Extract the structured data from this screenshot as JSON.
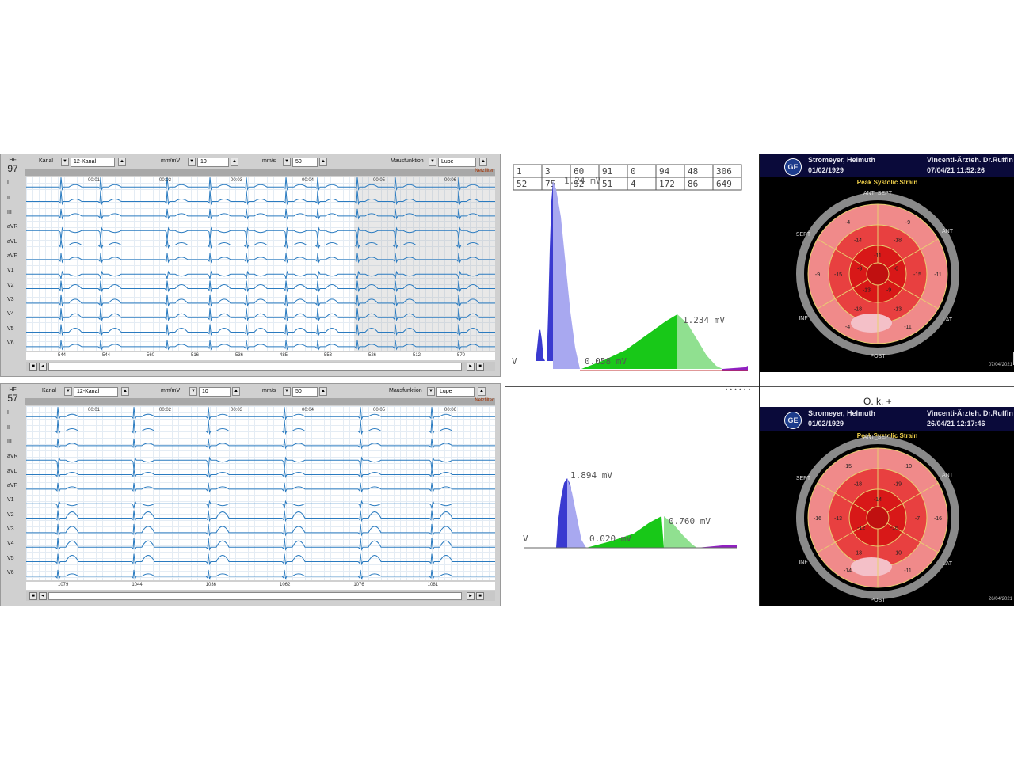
{
  "ecg_top": {
    "hf_label": "HF",
    "hf_value": "97",
    "kanal_label": "Kanal",
    "kanal_value": "12-Kanal",
    "mmmv_label": "mm/mV",
    "mmmv_value": "10",
    "mms_label": "mm/s",
    "mms_value": "50",
    "maus_label": "Mausfunktion",
    "maus_value": "Lupe",
    "netzfilter": "Netzfilter",
    "leads": [
      "I",
      "II",
      "III",
      "aVR",
      "aVL",
      "aVF",
      "V1",
      "V2",
      "V3",
      "V4",
      "V5",
      "V6"
    ],
    "times": [
      "00:01",
      "00:02",
      "00:03",
      "00:04",
      "00:05",
      "00:06"
    ],
    "rr_values": [
      "544",
      "544",
      "560",
      "516",
      "536",
      "485",
      "553",
      "526",
      "512",
      "570"
    ]
  },
  "ecg_bottom": {
    "hf_label": "HF",
    "hf_value": "57",
    "kanal_label": "Kanal",
    "kanal_value": "12-Kanal",
    "mmmv_label": "mm/mV",
    "mmmv_value": "10",
    "mms_label": "mm/s",
    "mms_value": "50",
    "maus_label": "Mausfunktion",
    "maus_value": "Lupe",
    "netzfilter": "Netzfilter",
    "leads": [
      "I",
      "II",
      "III",
      "aVR",
      "aVL",
      "aVF",
      "V1",
      "V2",
      "V3",
      "V4",
      "V5",
      "V6"
    ],
    "times": [
      "00:01",
      "00:02",
      "00:03",
      "00:04",
      "00:05",
      "00:06"
    ],
    "rr_values": [
      "1079",
      "1044",
      "1036",
      "1062",
      "1076",
      "1081"
    ]
  },
  "spectrum_top": {
    "table": [
      [
        "1",
        "3",
        "60",
        "91",
        "0",
        "94",
        "48",
        "306"
      ],
      [
        "52",
        "75",
        "92",
        "51",
        "4",
        "172",
        "86",
        "649"
      ]
    ],
    "label_overlap": "1.24 mV",
    "label_mid": "0.058 mV",
    "label_right": "1.234 mV",
    "edge_label": "V",
    "colors": {
      "blue_dark": "#3a3ad0",
      "blue_light": "#a8a8f0",
      "green_dark": "#18c818",
      "green_light": "#90e090",
      "purple": "#9020c0"
    }
  },
  "spectrum_bottom": {
    "label_peak": "1.894 mV",
    "label_mid": "0.020 mV",
    "label_right": "0.760 mV",
    "edge_label": "V"
  },
  "ok_label": "O. k. +",
  "bullseye_top": {
    "patient": "Stromeyer, Helmuth",
    "dob": "01/02/1929",
    "clinic": "Vincenti-Ärzteh. Dr.Ruffin",
    "datetime": "07/04/21 11:52:26",
    "title": "Peak Systolic Strain",
    "segments": {
      "ant_sept": "ANT_SEPT",
      "ant": "ANT",
      "lat": "LAT",
      "post": "POST",
      "inf": "INF",
      "sept": "SEPT"
    },
    "values": [
      "-9",
      "-11",
      "-11",
      "-4",
      "-9",
      "-4",
      "-18",
      "-15",
      "-13",
      "-18",
      "-15",
      "-14",
      "-11",
      "-6",
      "-9",
      "-13",
      "-9"
    ],
    "footer_date": "07/04/2021"
  },
  "bullseye_bottom": {
    "patient": "Stromeyer, Helmuth",
    "dob": "01/02/1929",
    "clinic": "Vincenti-Ärzteh. Dr.Ruffin",
    "datetime": "26/04/21 12:17:46",
    "title": "Peak Systolic Strain",
    "segments": {
      "ant_sept": "ANT_SEPT",
      "ant": "ANT",
      "lat": "LAT",
      "post": "POST",
      "inf": "INF",
      "sept": "SEPT"
    },
    "values": [
      "-10",
      "-16",
      "-11",
      "-14",
      "-16",
      "-15",
      "-19",
      "-7",
      "-10",
      "-13",
      "-13",
      "-18",
      "-14",
      "-16",
      "-12"
    ],
    "footer_date": "26/04/2021"
  }
}
